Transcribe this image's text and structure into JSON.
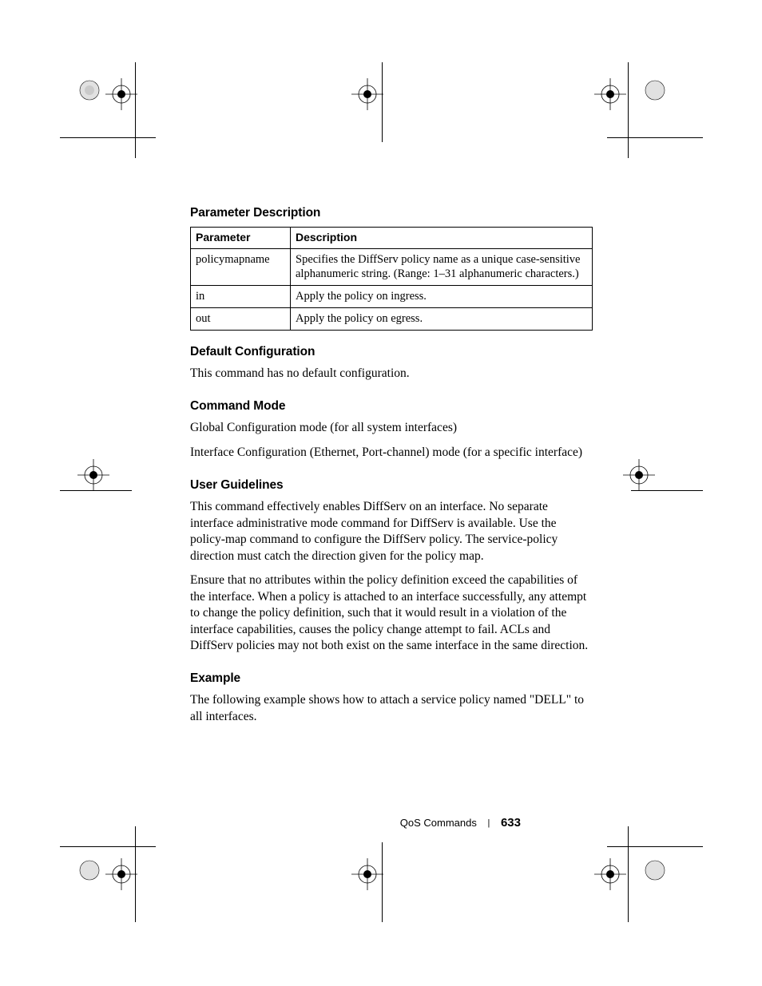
{
  "sections": {
    "param_desc_heading": "Parameter Description",
    "table": {
      "head": {
        "parameter": "Parameter",
        "description": "Description"
      },
      "rows": [
        {
          "p": "policymapname",
          "d": "Specifies the DiffServ policy name as a unique case-sensitive alphanumeric string. (Range: 1–31 alphanumeric characters.)"
        },
        {
          "p": "in",
          "d": "Apply the policy on ingress."
        },
        {
          "p": "out",
          "d": "Apply the policy on egress."
        }
      ]
    },
    "default_cfg_heading": "Default Configuration",
    "default_cfg_text": "This command has no default configuration.",
    "cmd_mode_heading": "Command Mode",
    "cmd_mode_p1": "Global Configuration mode (for all system interfaces)",
    "cmd_mode_p2": "Interface Configuration  (Ethernet, Port-channel) mode (for a specific interface)",
    "user_guidelines_heading": "User Guidelines",
    "user_guidelines_p1": "This command effectively enables DiffServ on an interface. No separate interface administrative mode command for DiffServ is available. Use the policy-map command to configure the DiffServ policy. The service-policy direction must catch the direction given for the policy map.",
    "user_guidelines_p2": "Ensure that no attributes within the policy definition exceed the capabilities of the interface. When a policy is attached to an interface successfully, any attempt to change the policy definition, such that it would result in a violation of the interface capabilities, causes the policy change attempt to fail. ACLs and DiffServ policies may not both exist on the same interface in the same direction.",
    "example_heading": "Example",
    "example_text": "The following example shows how to attach a service policy named \"DELL\" to all interfaces."
  },
  "footer": {
    "chapter": "QoS Commands",
    "page": "633"
  }
}
